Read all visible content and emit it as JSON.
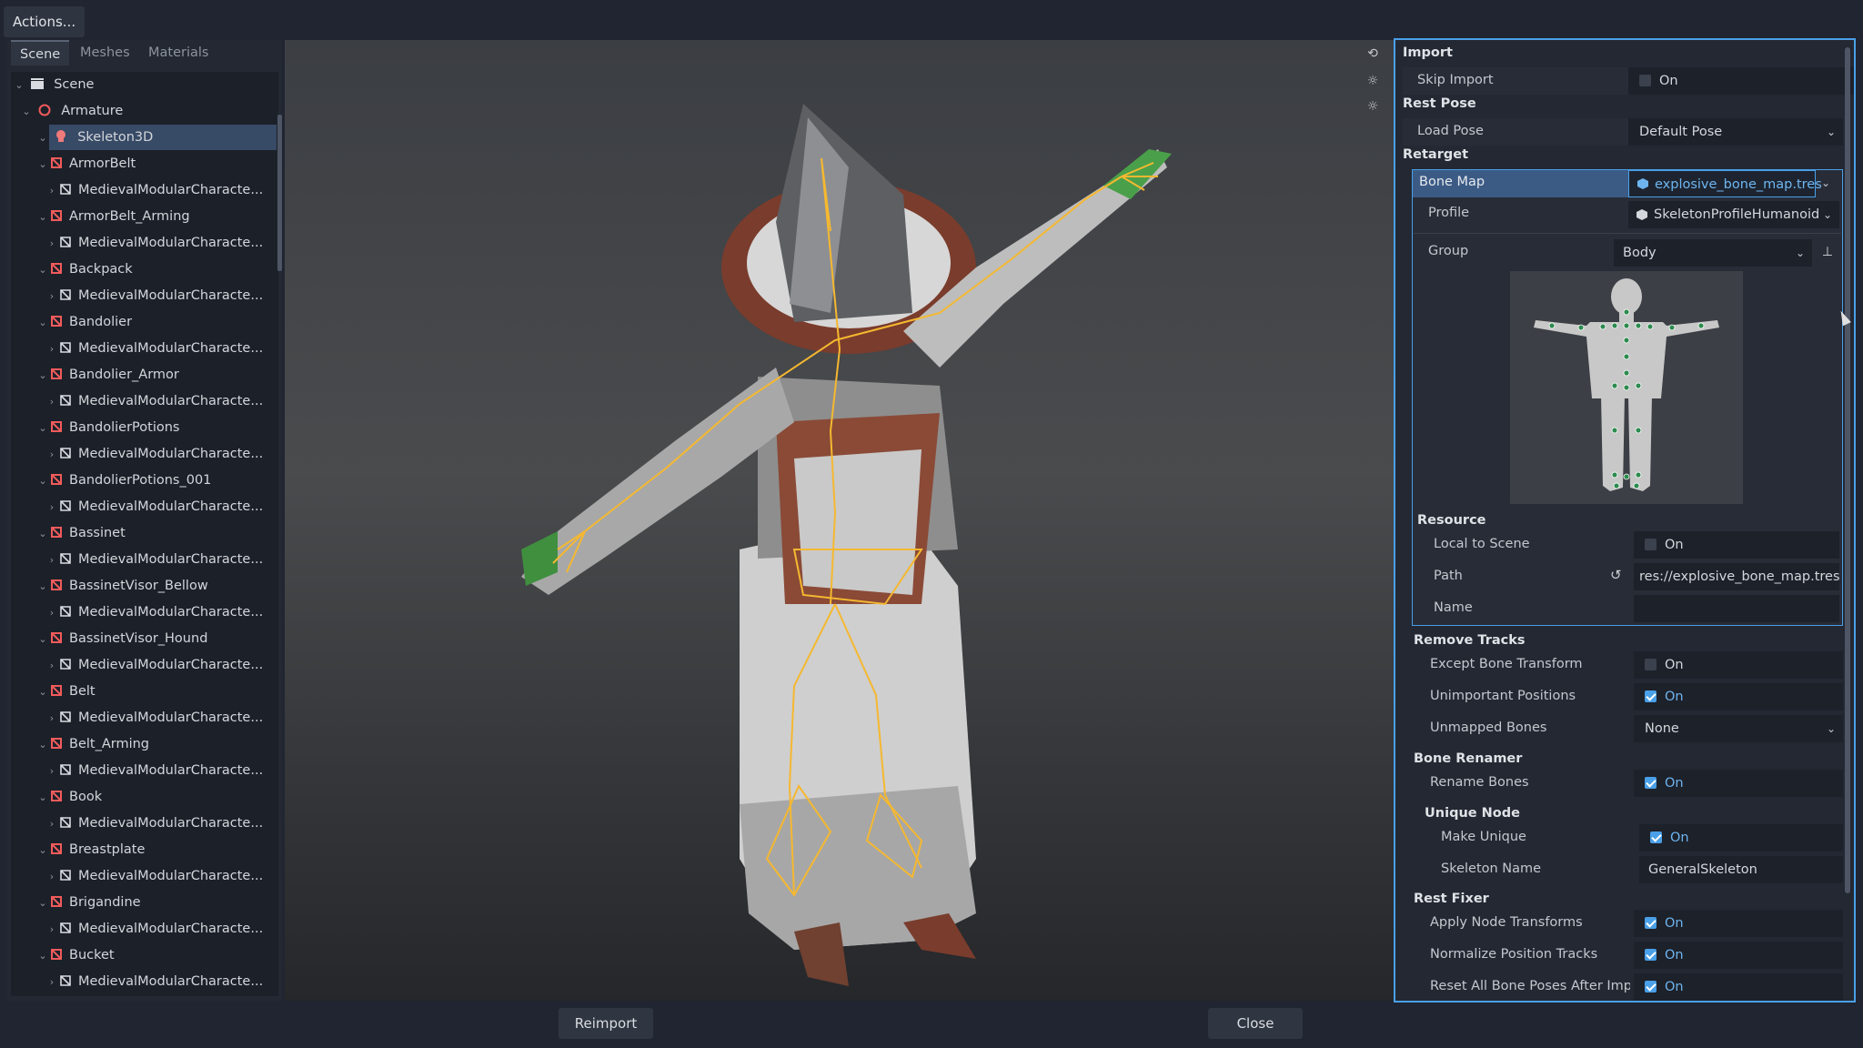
{
  "toolbar": {
    "actions_label": "Actions..."
  },
  "left_tabs": [
    "Scene",
    "Meshes",
    "Materials"
  ],
  "tree": {
    "root": "Scene",
    "armature": "Armature",
    "skeleton": "Skeleton3D",
    "bones": [
      {
        "name": "ArmorBelt",
        "child": "MedievalModularCharacte..."
      },
      {
        "name": "ArmorBelt_Arming",
        "child": "MedievalModularCharacte..."
      },
      {
        "name": "Backpack",
        "child": "MedievalModularCharacte..."
      },
      {
        "name": "Bandolier",
        "child": "MedievalModularCharacte..."
      },
      {
        "name": "Bandolier_Armor",
        "child": "MedievalModularCharacte..."
      },
      {
        "name": "BandolierPotions",
        "child": "MedievalModularCharacte..."
      },
      {
        "name": "BandolierPotions_001",
        "child": "MedievalModularCharacte..."
      },
      {
        "name": "Bassinet",
        "child": "MedievalModularCharacte..."
      },
      {
        "name": "BassinetVisor_Bellow",
        "child": "MedievalModularCharacte..."
      },
      {
        "name": "BassinetVisor_Hound",
        "child": "MedievalModularCharacte..."
      },
      {
        "name": "Belt",
        "child": "MedievalModularCharacte..."
      },
      {
        "name": "Belt_Arming",
        "child": "MedievalModularCharacte..."
      },
      {
        "name": "Book",
        "child": "MedievalModularCharacte..."
      },
      {
        "name": "Breastplate",
        "child": "MedievalModularCharacte..."
      },
      {
        "name": "Brigandine",
        "child": "MedievalModularCharacte..."
      },
      {
        "name": "Bucket",
        "child": "MedievalModularCharacte..."
      }
    ]
  },
  "inspector": {
    "import": {
      "title": "Import",
      "skip_import_label": "Skip Import",
      "skip_import_value": "On"
    },
    "rest_pose": {
      "title": "Rest Pose",
      "load_pose_label": "Load Pose",
      "load_pose_value": "Default Pose"
    },
    "retarget": {
      "title": "Retarget",
      "bone_map_label": "Bone Map",
      "bone_map_value": "explosive_bone_map.tres",
      "profile_label": "Profile",
      "profile_value": "SkeletonProfileHumanoid",
      "group_label": "Group",
      "group_value": "Body"
    },
    "resource": {
      "title": "Resource",
      "local_to_scene_label": "Local to Scene",
      "local_to_scene_value": "On",
      "path_label": "Path",
      "path_value": "res://explosive_bone_map.tres",
      "name_label": "Name",
      "name_value": ""
    },
    "remove_tracks": {
      "title": "Remove Tracks",
      "except_bone_transform_label": "Except Bone Transform",
      "except_bone_transform_value": "On",
      "unimportant_positions_label": "Unimportant Positions",
      "unimportant_positions_value": "On",
      "unmapped_bones_label": "Unmapped Bones",
      "unmapped_bones_value": "None"
    },
    "bone_renamer": {
      "title": "Bone Renamer",
      "rename_bones_label": "Rename Bones",
      "rename_bones_value": "On"
    },
    "unique_node": {
      "title": "Unique Node",
      "make_unique_label": "Make Unique",
      "make_unique_value": "On",
      "skeleton_name_label": "Skeleton Name",
      "skeleton_name_value": "GeneralSkeleton"
    },
    "rest_fixer": {
      "title": "Rest Fixer",
      "apply_node_transforms_label": "Apply Node Transforms",
      "apply_node_transforms_value": "On",
      "normalize_position_tracks_label": "Normalize Position Tracks",
      "normalize_position_tracks_value": "On",
      "reset_all_bone_poses_label": "Reset All Bone Poses After Impor",
      "reset_all_bone_poses_value": "On"
    }
  },
  "footer": {
    "reimport_label": "Reimport",
    "close_label": "Close"
  },
  "colors": {
    "accent": "#4aa0e8",
    "bone": "#f5b830",
    "selected_row": "#374a66"
  },
  "icons": [
    "scene-icon",
    "armature-icon",
    "skeleton-icon",
    "bone-icon",
    "mesh-icon",
    "reset-icon",
    "gizmo-icon",
    "light-icon",
    "pin-icon"
  ]
}
